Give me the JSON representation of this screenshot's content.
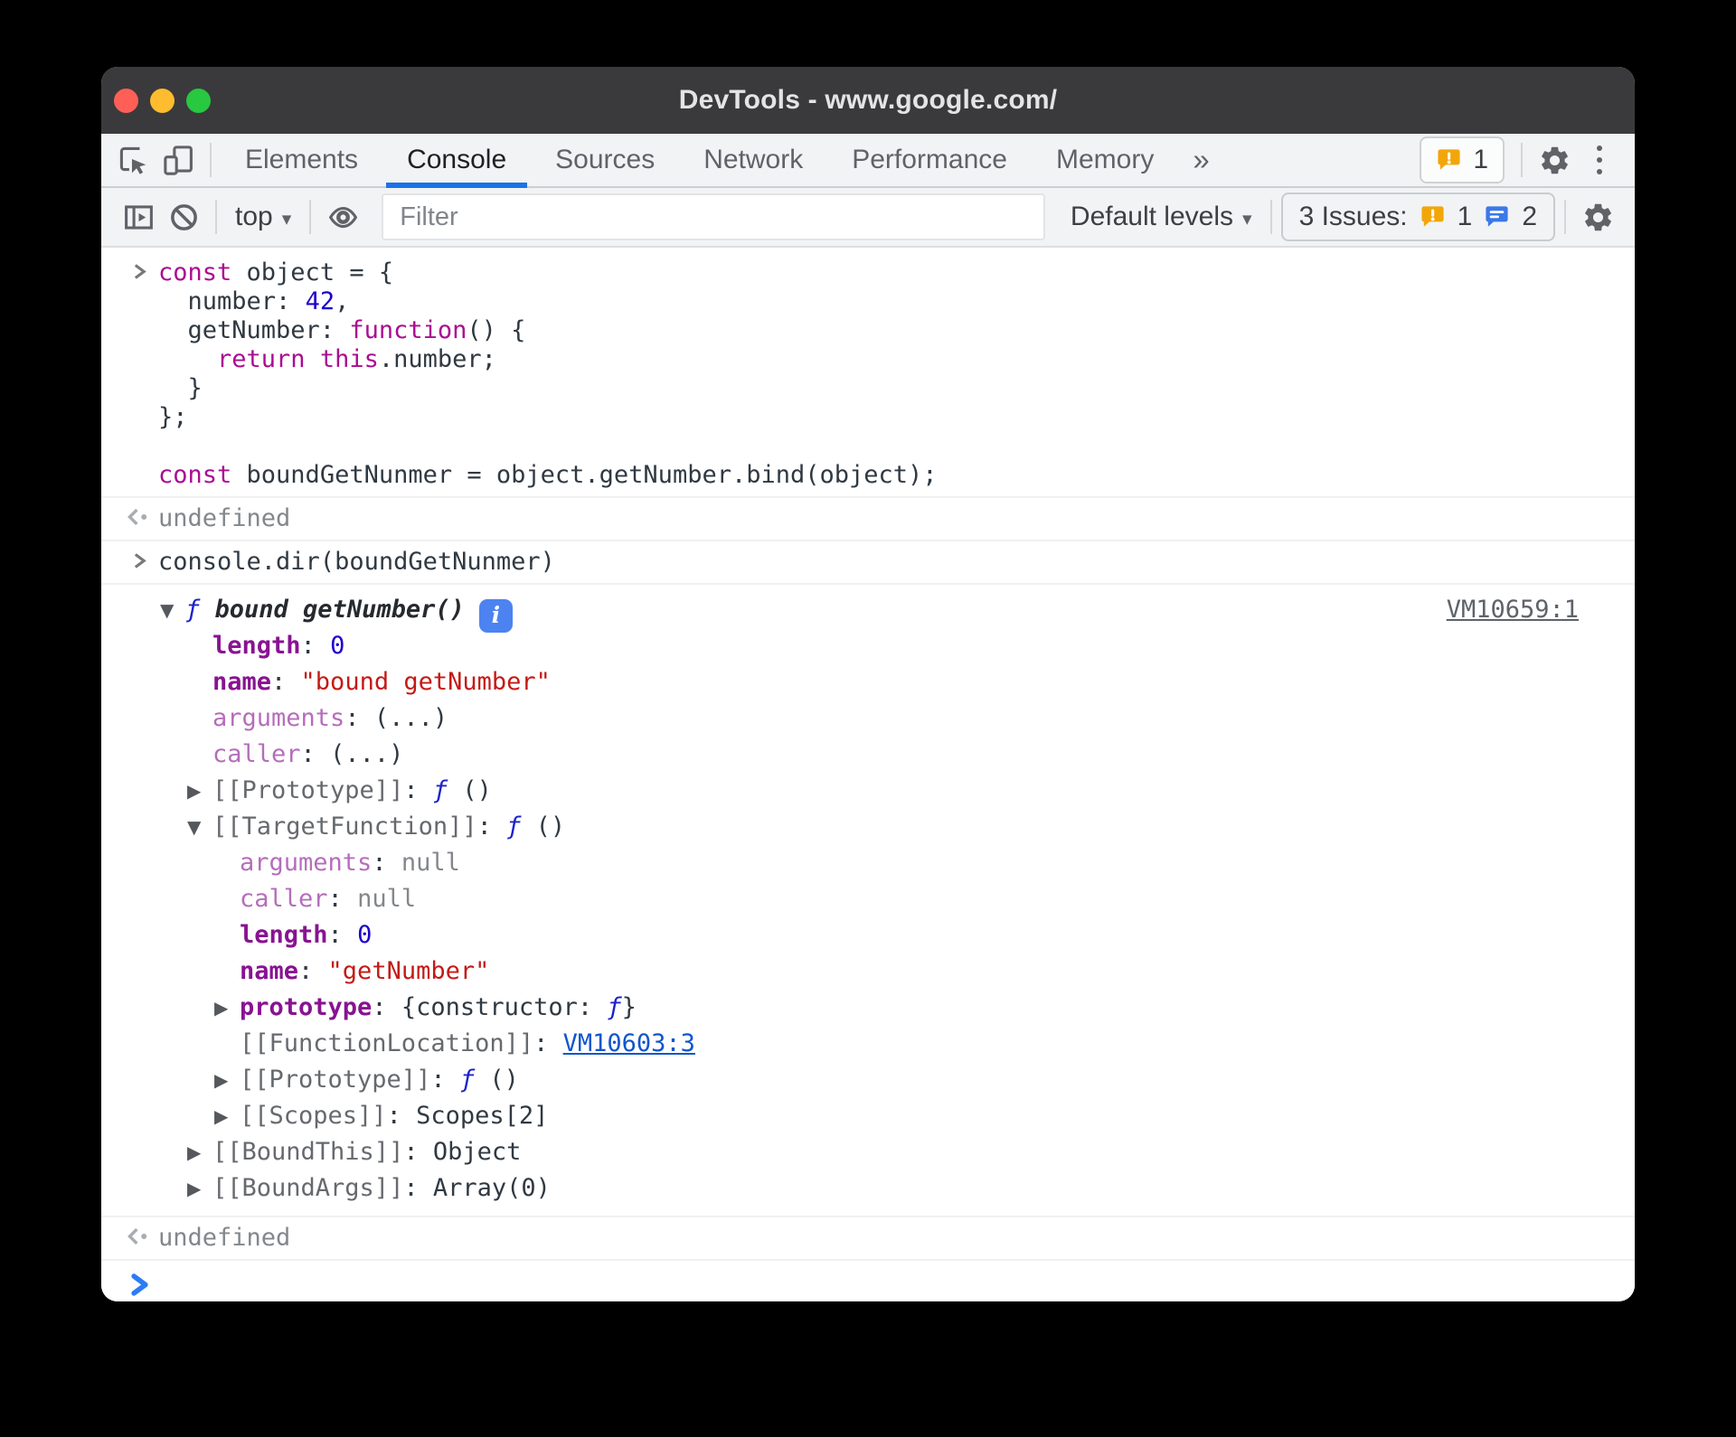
{
  "colors": {
    "accent_blue": "#1a73e8",
    "warning_orange": "#f2a60a",
    "issue_blue": "#3b78e8",
    "info_badge_blue": "#4c83f1",
    "link_blue": "#1155cc"
  },
  "window": {
    "title": "DevTools - www.google.com/"
  },
  "tab_bar": {
    "tabs": [
      {
        "label": "Elements",
        "active": false
      },
      {
        "label": "Console",
        "active": true
      },
      {
        "label": "Sources",
        "active": false
      },
      {
        "label": "Network",
        "active": false
      },
      {
        "label": "Performance",
        "active": false
      },
      {
        "label": "Memory",
        "active": false
      }
    ],
    "more_tabs_symbol": "»",
    "error_badge_count": "1"
  },
  "toolbar": {
    "context_selector": "top",
    "filter_placeholder": "Filter",
    "levels_selector": "Default levels",
    "issues_label": "3 Issues:",
    "issues_warning_count": "1",
    "issues_info_count": "2"
  },
  "console": {
    "messages": [
      {
        "kind": "input",
        "lines": [
          [
            {
              "s": "kw",
              "t": "const"
            },
            {
              "s": "p",
              "t": " object = {"
            }
          ],
          [
            {
              "s": "p",
              "t": "  number: "
            },
            {
              "s": "num",
              "t": "42"
            },
            {
              "s": "p",
              "t": ","
            }
          ],
          [
            {
              "s": "p",
              "t": "  getNumber: "
            },
            {
              "s": "kw",
              "t": "function"
            },
            {
              "s": "p",
              "t": "() {"
            }
          ],
          [
            {
              "s": "p",
              "t": "    "
            },
            {
              "s": "kw",
              "t": "return"
            },
            {
              "s": "p",
              "t": " "
            },
            {
              "s": "kw",
              "t": "this"
            },
            {
              "s": "p",
              "t": ".number;"
            }
          ],
          [
            {
              "s": "p",
              "t": "  }"
            }
          ],
          [
            {
              "s": "p",
              "t": "};"
            }
          ],
          [],
          [
            {
              "s": "kw",
              "t": "const"
            },
            {
              "s": "p",
              "t": " boundGetNunmer = object.getNumber.bind(object);"
            }
          ]
        ]
      },
      {
        "kind": "result",
        "lines": [
          [
            {
              "s": "dim",
              "t": "undefined"
            }
          ]
        ]
      },
      {
        "kind": "input",
        "lines": [
          [
            {
              "s": "p",
              "t": "console.dir(boundGetNunmer)"
            }
          ]
        ]
      },
      {
        "kind": "tree",
        "source_link": "VM10659:1",
        "rows": [
          {
            "indent": 0,
            "exp": "open",
            "parts": [
              {
                "s": "fn",
                "t": "ƒ "
              },
              {
                "s": "fname",
                "t": "bound getNumber()"
              },
              {
                "s": "info",
                "t": "i"
              }
            ]
          },
          {
            "indent": 1,
            "parts": [
              {
                "s": "prop",
                "t": "length"
              },
              {
                "s": "p",
                "t": ": "
              },
              {
                "s": "num",
                "t": "0"
              }
            ]
          },
          {
            "indent": 1,
            "parts": [
              {
                "s": "prop",
                "t": "name"
              },
              {
                "s": "p",
                "t": ": "
              },
              {
                "s": "str",
                "t": "\"bound getNumber\""
              }
            ]
          },
          {
            "indent": 1,
            "parts": [
              {
                "s": "propfade",
                "t": "arguments"
              },
              {
                "s": "p",
                "t": ": "
              },
              {
                "s": "p",
                "t": "(...)"
              }
            ]
          },
          {
            "indent": 1,
            "parts": [
              {
                "s": "propfade",
                "t": "caller"
              },
              {
                "s": "p",
                "t": ": "
              },
              {
                "s": "p",
                "t": "(...)"
              }
            ]
          },
          {
            "indent": 1,
            "exp": "closed",
            "parts": [
              {
                "s": "internal",
                "t": "[[Prototype]]"
              },
              {
                "s": "p",
                "t": ": "
              },
              {
                "s": "fn",
                "t": "ƒ "
              },
              {
                "s": "p",
                "t": "()"
              }
            ]
          },
          {
            "indent": 1,
            "exp": "open",
            "parts": [
              {
                "s": "internal",
                "t": "[[TargetFunction]]"
              },
              {
                "s": "p",
                "t": ": "
              },
              {
                "s": "fn",
                "t": "ƒ "
              },
              {
                "s": "p",
                "t": "()"
              }
            ]
          },
          {
            "indent": 2,
            "parts": [
              {
                "s": "propfade",
                "t": "arguments"
              },
              {
                "s": "p",
                "t": ": "
              },
              {
                "s": "dim",
                "t": "null"
              }
            ]
          },
          {
            "indent": 2,
            "parts": [
              {
                "s": "propfade",
                "t": "caller"
              },
              {
                "s": "p",
                "t": ": "
              },
              {
                "s": "dim",
                "t": "null"
              }
            ]
          },
          {
            "indent": 2,
            "parts": [
              {
                "s": "prop",
                "t": "length"
              },
              {
                "s": "p",
                "t": ": "
              },
              {
                "s": "num",
                "t": "0"
              }
            ]
          },
          {
            "indent": 2,
            "parts": [
              {
                "s": "prop",
                "t": "name"
              },
              {
                "s": "p",
                "t": ": "
              },
              {
                "s": "str",
                "t": "\"getNumber\""
              }
            ]
          },
          {
            "indent": 2,
            "exp": "closed",
            "parts": [
              {
                "s": "prop",
                "t": "prototype"
              },
              {
                "s": "p",
                "t": ": "
              },
              {
                "s": "p",
                "t": "{constructor: "
              },
              {
                "s": "fn",
                "t": "ƒ"
              },
              {
                "s": "p",
                "t": "}"
              }
            ]
          },
          {
            "indent": 2,
            "parts": [
              {
                "s": "internal",
                "t": "[[FunctionLocation]]"
              },
              {
                "s": "p",
                "t": ": "
              },
              {
                "s": "bluelink",
                "t": "VM10603:3"
              }
            ]
          },
          {
            "indent": 2,
            "exp": "closed",
            "parts": [
              {
                "s": "internal",
                "t": "[[Prototype]]"
              },
              {
                "s": "p",
                "t": ": "
              },
              {
                "s": "fn",
                "t": "ƒ "
              },
              {
                "s": "p",
                "t": "()"
              }
            ]
          },
          {
            "indent": 2,
            "exp": "closed",
            "parts": [
              {
                "s": "internal",
                "t": "[[Scopes]]"
              },
              {
                "s": "p",
                "t": ": "
              },
              {
                "s": "p",
                "t": "Scopes[2]"
              }
            ]
          },
          {
            "indent": 1,
            "exp": "closed",
            "parts": [
              {
                "s": "internal",
                "t": "[[BoundThis]]"
              },
              {
                "s": "p",
                "t": ": "
              },
              {
                "s": "p",
                "t": "Object"
              }
            ]
          },
          {
            "indent": 1,
            "exp": "closed",
            "parts": [
              {
                "s": "internal",
                "t": "[[BoundArgs]]"
              },
              {
                "s": "p",
                "t": ": "
              },
              {
                "s": "p",
                "t": "Array(0)"
              }
            ]
          }
        ]
      },
      {
        "kind": "result",
        "lines": [
          [
            {
              "s": "dim",
              "t": "undefined"
            }
          ]
        ]
      },
      {
        "kind": "prompt"
      }
    ]
  }
}
